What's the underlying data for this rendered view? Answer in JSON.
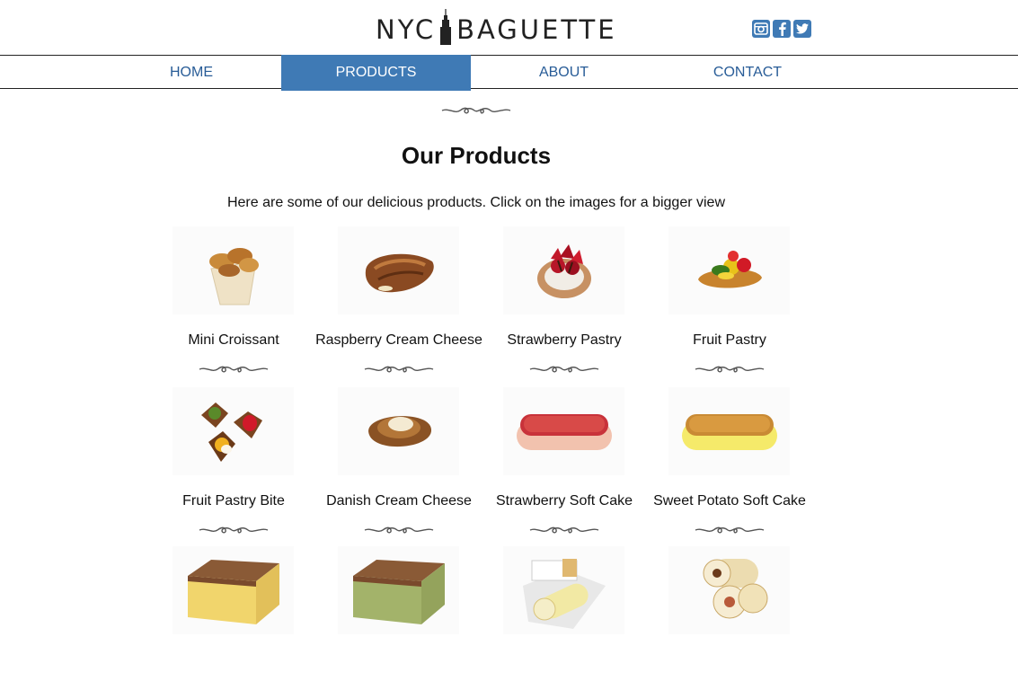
{
  "header": {
    "logo_left": "NYC",
    "logo_right": "BAGUETTE",
    "social": [
      {
        "name": "instagram-icon",
        "glyph": "◙"
      },
      {
        "name": "facebook-icon",
        "glyph": "f"
      },
      {
        "name": "twitter-icon",
        "glyph": "t"
      }
    ]
  },
  "nav": {
    "items": [
      {
        "label": "HOME",
        "active": false
      },
      {
        "label": "PRODUCTS",
        "active": true
      },
      {
        "label": "ABOUT",
        "active": false
      },
      {
        "label": "CONTACT",
        "active": false
      }
    ]
  },
  "main": {
    "title": "Our Products",
    "intro": "Here are some of our delicious products. Click on the images for a bigger view",
    "products": [
      {
        "name": "Mini Croissant",
        "img": "croissant"
      },
      {
        "name": "Raspberry Cream Cheese",
        "img": "danish-brown"
      },
      {
        "name": "Strawberry Pastry",
        "img": "strawberry-pastry"
      },
      {
        "name": "Fruit Pastry",
        "img": "fruit-pastry"
      },
      {
        "name": "Fruit Pastry Bite",
        "img": "pastry-bites"
      },
      {
        "name": "Danish Cream Cheese",
        "img": "danish-cream"
      },
      {
        "name": "Strawberry Soft Cake",
        "img": "soft-cake-red"
      },
      {
        "name": "Sweet Potato Soft Cake",
        "img": "soft-cake-yellow"
      },
      {
        "name": "",
        "img": "castella"
      },
      {
        "name": "",
        "img": "castella-green"
      },
      {
        "name": "",
        "img": "roll-cake-box"
      },
      {
        "name": "",
        "img": "roll-cake-slices"
      }
    ]
  },
  "colors": {
    "accent": "#3f7ab5",
    "nav_text": "#285c97"
  }
}
